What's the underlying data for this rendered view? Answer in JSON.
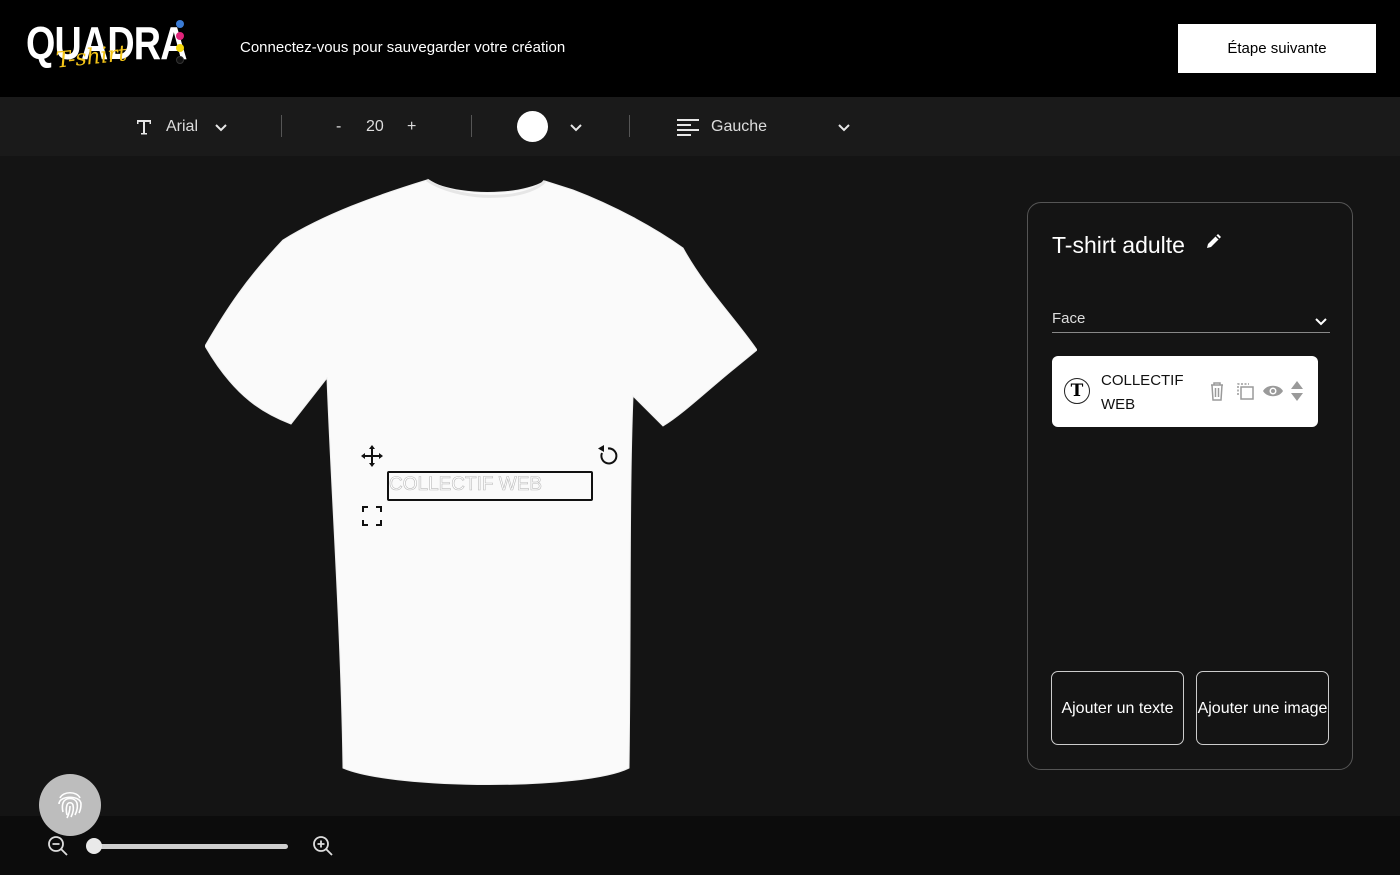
{
  "header": {
    "logo_text": "QUADRA",
    "logo_script": "T-shirt",
    "login_message": "Connectez-vous pour sauvegarder votre création",
    "next_button": "Étape suivante",
    "dot_colors": [
      "#3a7bd5",
      "#e0237a",
      "#f5d90a",
      "#111111"
    ]
  },
  "toolbar": {
    "font_icon": "text-t-icon",
    "font_name": "Arial",
    "size_minus": "-",
    "font_size": "20",
    "size_plus": "+",
    "color_value": "#ffffff",
    "align_icon": "align-left-icon",
    "align_label": "Gauche"
  },
  "canvas": {
    "product_color": "#ffffff",
    "text_element": "COLLECTIF WEB"
  },
  "panel": {
    "title": "T-shirt adulte",
    "side_select": "Face",
    "layers": [
      {
        "type_icon": "text-t-icon",
        "name": "COLLECTIF WEB"
      }
    ],
    "add_text_button": "Ajouter un texte",
    "add_image_button": "Ajouter une image"
  },
  "zoom": {
    "level": 0.02
  }
}
